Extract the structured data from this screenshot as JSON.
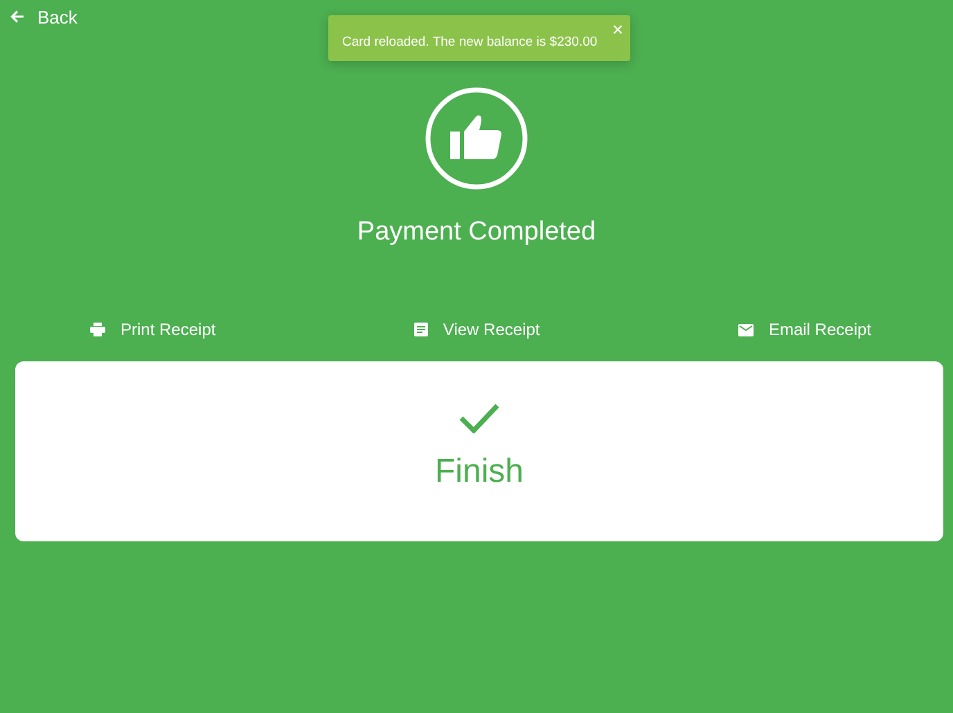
{
  "nav": {
    "back_label": "Back"
  },
  "toast": {
    "message": "Card reloaded. The new balance is $230.00",
    "close": "×"
  },
  "status": {
    "title": "Payment Completed"
  },
  "actions": [
    {
      "kind": "print",
      "label": "Print Receipt"
    },
    {
      "kind": "view",
      "label": "View Receipt"
    },
    {
      "kind": "email",
      "label": "Email Receipt"
    }
  ],
  "finish": {
    "label": "Finish"
  }
}
